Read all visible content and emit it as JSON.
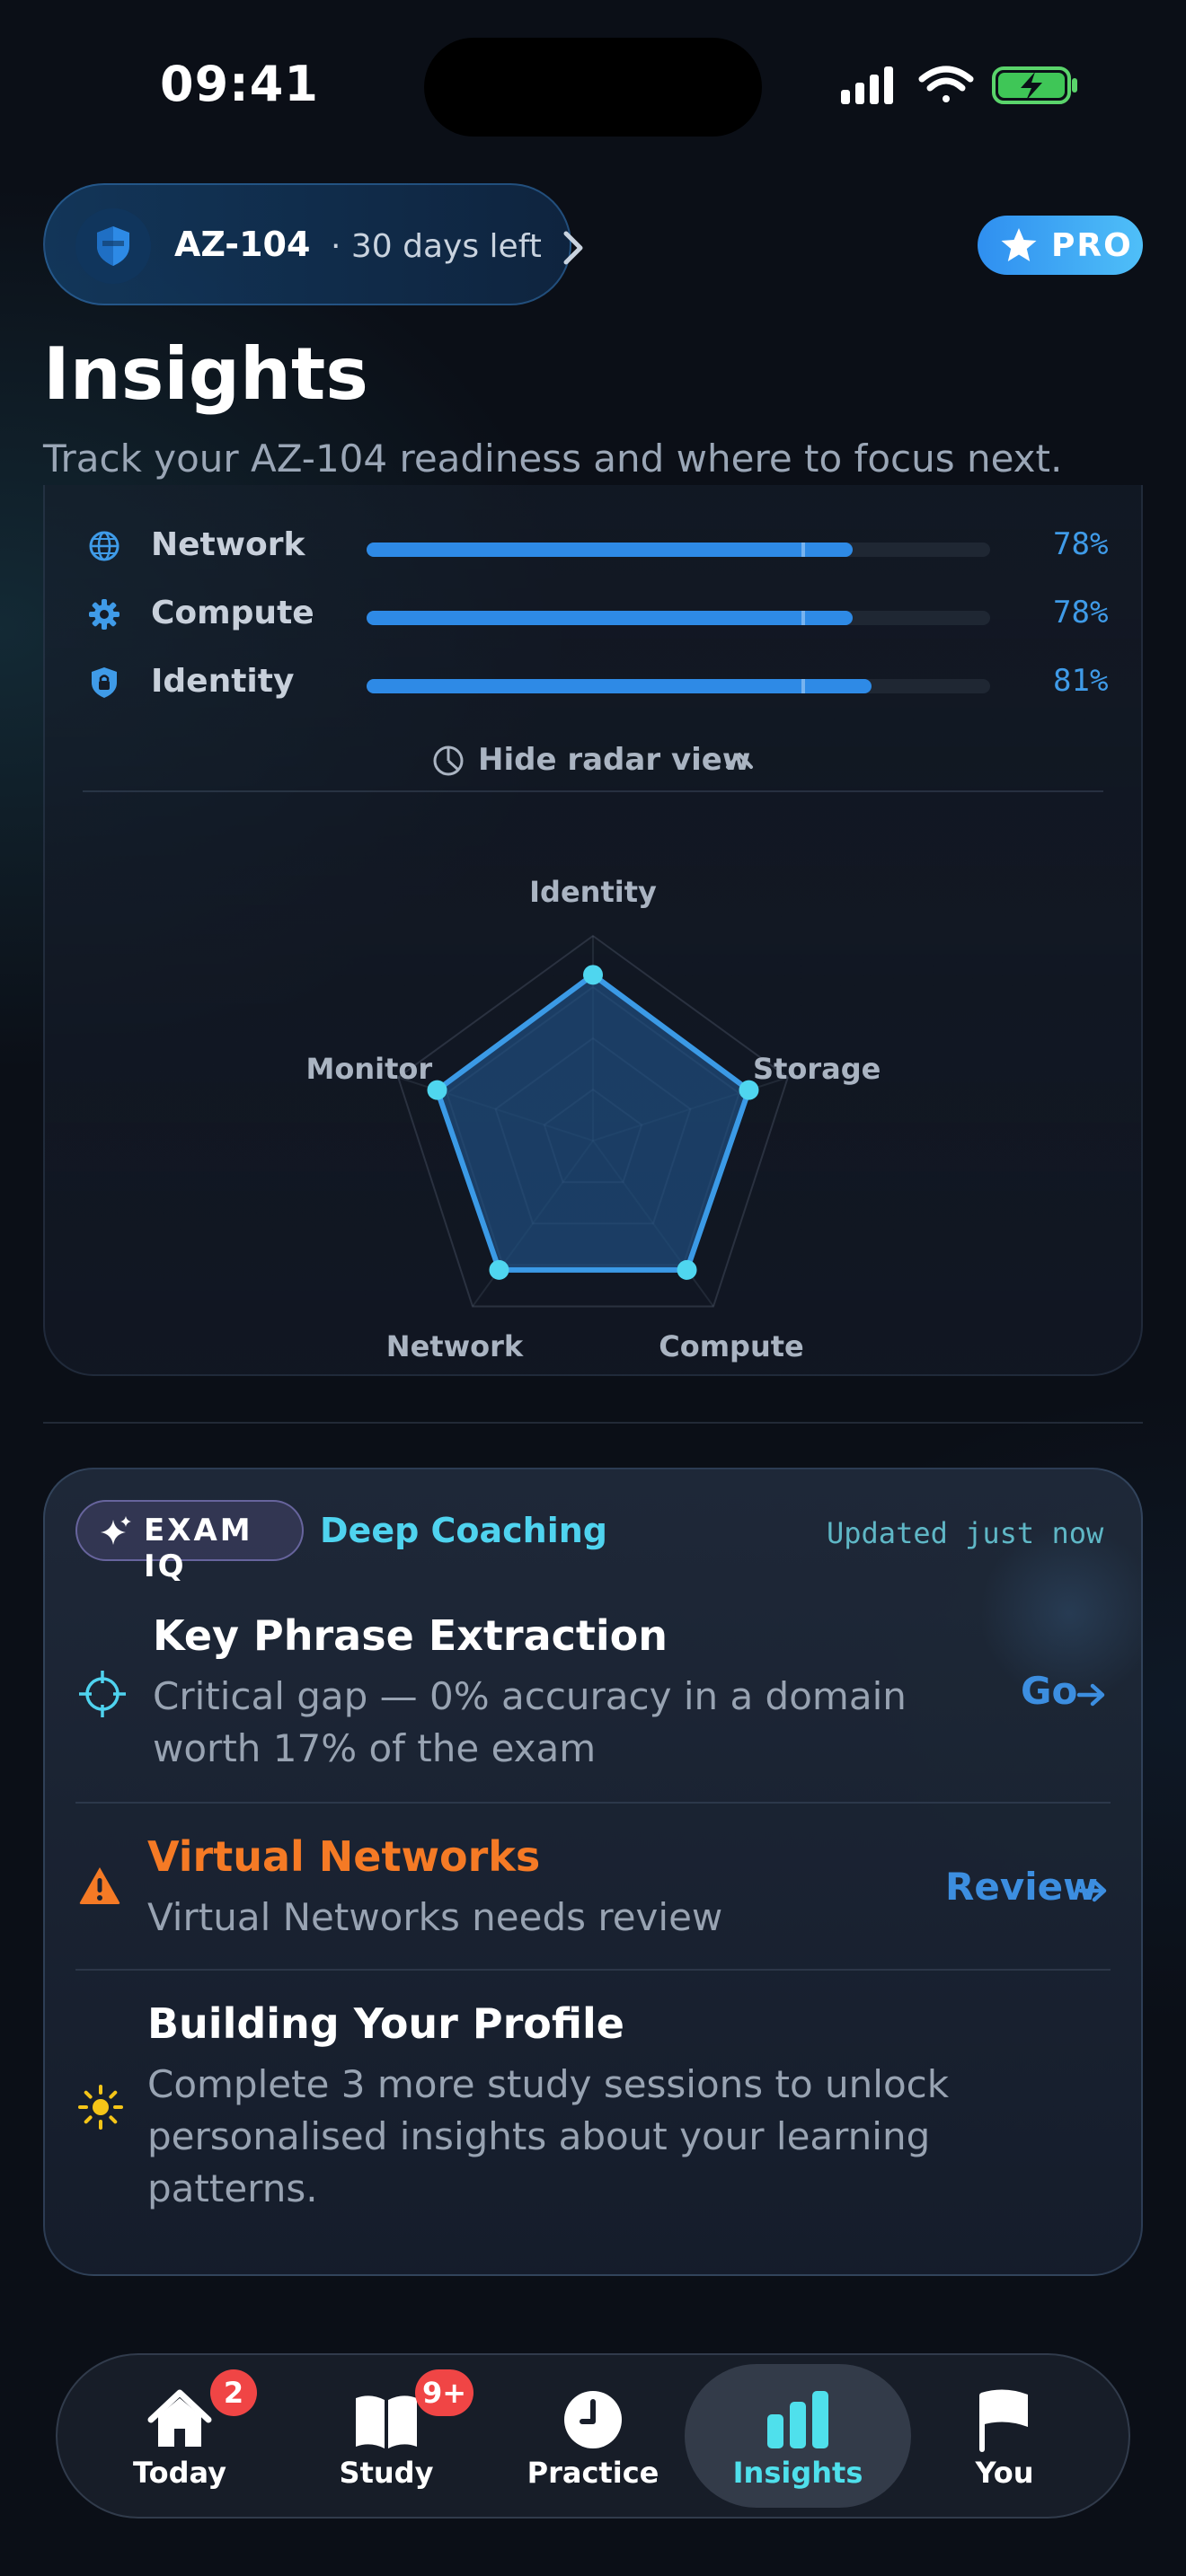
{
  "status_bar": {
    "time": "09:41"
  },
  "exam_pill": {
    "code": "AZ-104",
    "days_left": "· 30 days left"
  },
  "pro_badge": "PRO",
  "header": {
    "title": "Insights",
    "subtitle": "Track your AZ-104 readiness and where to focus next."
  },
  "domains": [
    {
      "name": "Network",
      "percent": "78%",
      "value": 0.78,
      "icon": "globe-icon"
    },
    {
      "name": "Compute",
      "percent": "78%",
      "value": 0.78,
      "icon": "gear-icon"
    },
    {
      "name": "Identity",
      "percent": "81%",
      "value": 0.81,
      "icon": "lock-shield-icon"
    }
  ],
  "radar_toggle": "Hide radar view",
  "chart_data": {
    "type": "radar",
    "axes": [
      "Identity",
      "Storage",
      "Compute",
      "Network",
      "Monitor"
    ],
    "values": [
      0.81,
      0.8,
      0.78,
      0.78,
      0.8
    ],
    "range": [
      0,
      1
    ],
    "rings": 4,
    "colors": {
      "line": "#3b9ae6",
      "fill": "#1f4f80",
      "point": "#4fd6ef"
    }
  },
  "exam_iq": {
    "badge": "EXAM IQ",
    "mode": "Deep Coaching",
    "updated": "Updated just now",
    "insights": [
      {
        "title": "Key Phrase Extraction",
        "body_line1": "Critical gap — 0% accuracy in a domain",
        "body_line2": "worth 17% of the exam",
        "action": "Go",
        "icon": "crosshair-icon",
        "color": "#ffffff"
      },
      {
        "title": "Virtual Networks",
        "body_line1": "Virtual Networks needs review",
        "action": "Review",
        "icon": "warning-icon",
        "color": "#f57a25"
      },
      {
        "title": "Building Your Profile",
        "body_line1": "Complete 3 more study sessions to unlock",
        "body_line2": "personalised insights about your learning",
        "body_line3": "patterns.",
        "icon": "sun-icon",
        "color": "#ffffff"
      }
    ]
  },
  "tabs": [
    {
      "label": "Today",
      "badge": "2",
      "icon": "home-icon"
    },
    {
      "label": "Study",
      "badge": "9+",
      "icon": "book-icon"
    },
    {
      "label": "Practice",
      "icon": "clock-icon"
    },
    {
      "label": "Insights",
      "icon": "bar-chart-icon",
      "active": true
    },
    {
      "label": "You",
      "icon": "flag-icon"
    }
  ],
  "colors": {
    "accent": "#2e8ae6",
    "cyan": "#4fd3ef",
    "warning": "#f57a25",
    "badge": "#f04545"
  }
}
